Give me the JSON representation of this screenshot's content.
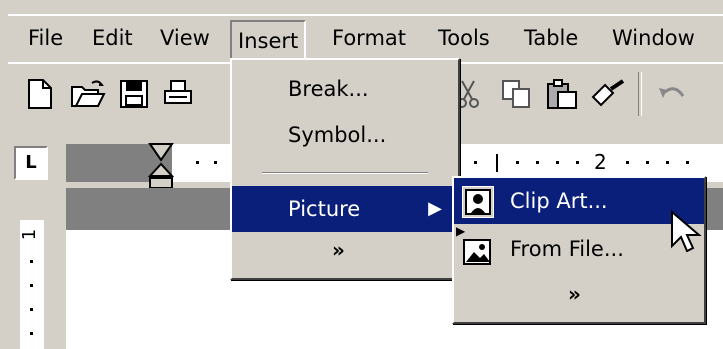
{
  "menubar": {
    "items": [
      {
        "label": "File"
      },
      {
        "label": "Edit"
      },
      {
        "label": "View"
      },
      {
        "label": "Insert"
      },
      {
        "label": "Format"
      },
      {
        "label": "Tools"
      },
      {
        "label": "Table"
      },
      {
        "label": "Window"
      }
    ]
  },
  "insert_menu": {
    "items": [
      {
        "label": "Break..."
      },
      {
        "label": "Symbol..."
      },
      {
        "label": "Picture"
      }
    ],
    "expand_glyph": "»"
  },
  "picture_submenu": {
    "items": [
      {
        "label": "Clip Art..."
      },
      {
        "label": "From File..."
      }
    ],
    "expand_glyph": "»"
  },
  "ruler": {
    "tick_label": "2"
  },
  "vruler": {
    "tick_label": "1"
  },
  "ruler_box": {
    "label": "L"
  },
  "colors": {
    "highlight": "#0a1f7a",
    "face": "#d4d0c8"
  },
  "toolbar": {
    "icons": [
      "new-document-icon",
      "open-folder-icon",
      "save-icon",
      "print-icon",
      "cut-icon",
      "copy-icon",
      "paste-icon",
      "format-painter-icon",
      "undo-icon"
    ]
  }
}
